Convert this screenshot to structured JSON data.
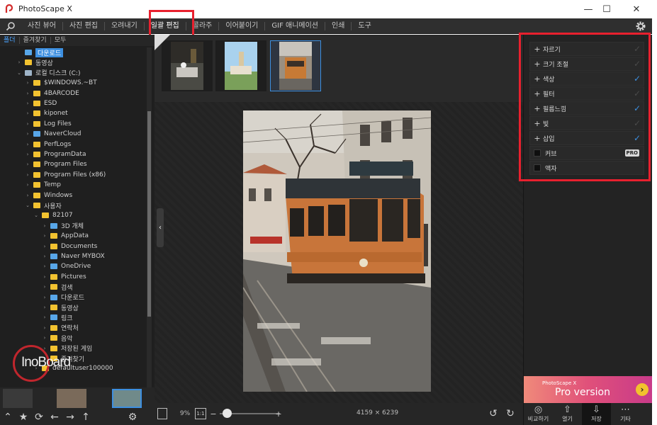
{
  "app": {
    "title": "PhotoScape X"
  },
  "window_controls": {
    "minimize": "—",
    "maximize": "☐",
    "close": "✕"
  },
  "menu": {
    "tabs": [
      "사진 뷰어",
      "사진 편집",
      "오려내기",
      "일괄 편집",
      "콜라주",
      "이어붙이기",
      "GIF 애니메이션",
      "인쇄",
      "도구"
    ],
    "active": "일괄 편집"
  },
  "left_panel": {
    "tabs": [
      "폴더",
      "즐겨찾기",
      "모두"
    ],
    "tree": [
      {
        "label": "다운로드",
        "depth": 1,
        "icon": "blue",
        "arrow": "",
        "selected": true
      },
      {
        "label": "동영상",
        "depth": 1,
        "icon": "yellow",
        "arrow": "›"
      },
      {
        "label": "로컬 디스크 (C:)",
        "depth": 1,
        "icon": "drive",
        "arrow": "⌄"
      },
      {
        "label": "$WINDOWS.~BT",
        "depth": 2,
        "icon": "yellow",
        "arrow": "›"
      },
      {
        "label": "4BARCODE",
        "depth": 2,
        "icon": "yellow",
        "arrow": "›"
      },
      {
        "label": "ESD",
        "depth": 2,
        "icon": "yellow",
        "arrow": "›"
      },
      {
        "label": "kiponet",
        "depth": 2,
        "icon": "yellow",
        "arrow": "›"
      },
      {
        "label": "Log Files",
        "depth": 2,
        "icon": "yellow",
        "arrow": "›"
      },
      {
        "label": "NaverCloud",
        "depth": 2,
        "icon": "blue",
        "arrow": "›"
      },
      {
        "label": "PerfLogs",
        "depth": 2,
        "icon": "yellow",
        "arrow": "›"
      },
      {
        "label": "ProgramData",
        "depth": 2,
        "icon": "yellow",
        "arrow": "›"
      },
      {
        "label": "Program Files",
        "depth": 2,
        "icon": "yellow",
        "arrow": "›"
      },
      {
        "label": "Program Files (x86)",
        "depth": 2,
        "icon": "yellow",
        "arrow": "›"
      },
      {
        "label": "Temp",
        "depth": 2,
        "icon": "yellow",
        "arrow": "›"
      },
      {
        "label": "Windows",
        "depth": 2,
        "icon": "yellow",
        "arrow": "›"
      },
      {
        "label": "사용자",
        "depth": 2,
        "icon": "yellow",
        "arrow": "⌄"
      },
      {
        "label": "82107",
        "depth": 3,
        "icon": "yellow",
        "arrow": "⌄"
      },
      {
        "label": "3D 개체",
        "depth": 4,
        "icon": "blue",
        "arrow": "›"
      },
      {
        "label": "AppData",
        "depth": 4,
        "icon": "yellow",
        "arrow": "›"
      },
      {
        "label": "Documents",
        "depth": 4,
        "icon": "yellow",
        "arrow": "›"
      },
      {
        "label": "Naver MYBOX",
        "depth": 4,
        "icon": "blue",
        "arrow": "›"
      },
      {
        "label": "OneDrive",
        "depth": 4,
        "icon": "blue",
        "arrow": "›"
      },
      {
        "label": "Pictures",
        "depth": 4,
        "icon": "yellow",
        "arrow": "›"
      },
      {
        "label": "검색",
        "depth": 4,
        "icon": "yellow",
        "arrow": "›"
      },
      {
        "label": "다운로드",
        "depth": 4,
        "icon": "blue",
        "arrow": "›"
      },
      {
        "label": "동영상",
        "depth": 4,
        "icon": "yellow",
        "arrow": "›"
      },
      {
        "label": "링크",
        "depth": 4,
        "icon": "blue",
        "arrow": "›"
      },
      {
        "label": "연락처",
        "depth": 4,
        "icon": "yellow",
        "arrow": "›"
      },
      {
        "label": "음악",
        "depth": 4,
        "icon": "yellow",
        "arrow": "›"
      },
      {
        "label": "저장된 게임",
        "depth": 4,
        "icon": "yellow",
        "arrow": "›"
      },
      {
        "label": "즐겨찾기",
        "depth": 4,
        "icon": "yellow",
        "arrow": "›"
      },
      {
        "label": "defaultuser100000",
        "depth": 3,
        "icon": "yellow",
        "arrow": "›"
      }
    ],
    "watermark": "InoBoard"
  },
  "center": {
    "zoom": "9%",
    "zoom_fit": "1:1",
    "image_dims": "4159 × 6239"
  },
  "right_panel": {
    "tools": [
      {
        "label": "자르기",
        "kind": "plus",
        "checked": false
      },
      {
        "label": "크기 조절",
        "kind": "plus",
        "checked": false
      },
      {
        "label": "색상",
        "kind": "plus",
        "checked": true
      },
      {
        "label": "필터",
        "kind": "plus",
        "checked": false
      },
      {
        "label": "필름느낌",
        "kind": "plus",
        "checked": true
      },
      {
        "label": "빛",
        "kind": "plus",
        "checked": false
      },
      {
        "label": "삽입",
        "kind": "plus",
        "checked": true
      },
      {
        "label": "커브",
        "kind": "box",
        "pro": "PRO"
      },
      {
        "label": "액자",
        "kind": "box"
      }
    ],
    "promo": {
      "small": "PhotoScape X",
      "big": "Pro version"
    },
    "actions": [
      {
        "label": "비교하기",
        "icon": "◎"
      },
      {
        "label": "열기",
        "icon": "⇧"
      },
      {
        "label": "저장",
        "icon": "⇩",
        "active": true
      },
      {
        "label": "기타",
        "icon": "⋯"
      }
    ]
  },
  "colors": {
    "accent": "#3d8fe0",
    "highlight_box": "#e8202e"
  }
}
